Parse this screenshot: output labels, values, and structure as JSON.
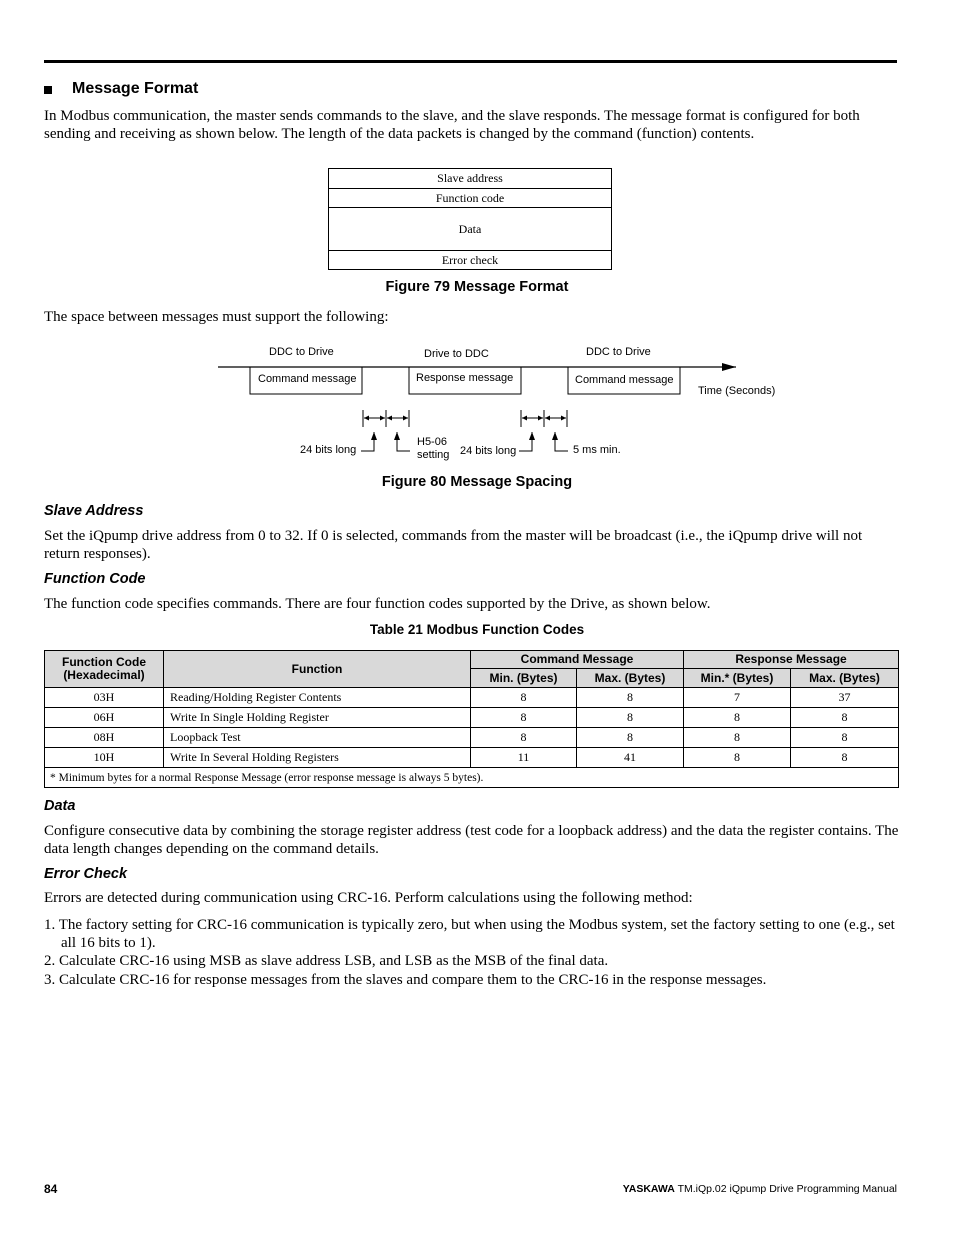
{
  "section": {
    "title": "Message Format",
    "intro": "In Modbus communication, the master sends commands to the slave, and the slave responds. The message format is configured for both sending and receiving as shown below. The length of the data packets is changed by the command (function) contents."
  },
  "figure79": {
    "fields": [
      "Slave address",
      "Function code",
      "Data",
      "Error check"
    ],
    "caption": "Figure 79  Message Format"
  },
  "spacing_intro": "The space between messages must support the following:",
  "figure80": {
    "top_labels": [
      "DDC to Drive",
      "Drive to DDC",
      "DDC to Drive"
    ],
    "boxes": [
      "Command message",
      "Response message",
      "Command message"
    ],
    "axis_label": "Time (Seconds)",
    "gap1_left_label": "24 bits long",
    "gap1_right_label_line1": "H5-06",
    "gap1_right_label_line2": "setting",
    "gap2_left_label": "24 bits long",
    "gap2_right_label": "5 ms min.",
    "caption": "Figure 80  Message Spacing"
  },
  "slave_address": {
    "heading": "Slave Address",
    "text": "Set the iQpump drive address from 0 to 32. If 0 is selected, commands from the master will be broadcast (i.e., the iQpump drive will not return responses)."
  },
  "function_code": {
    "heading": "Function Code",
    "text": "The function code specifies commands. There are four function codes supported by the Drive, as shown below."
  },
  "table21": {
    "caption": "Table 21   Modbus Function Codes",
    "headers": {
      "code": "Function Code (Hexadecimal)",
      "function": "Function",
      "command": "Command Message",
      "response": "Response Message",
      "cmd_min": "Min. (Bytes)",
      "cmd_max": "Max. (Bytes)",
      "resp_min": "Min.* (Bytes)",
      "resp_max": "Max. (Bytes)"
    },
    "rows": [
      {
        "code": "03H",
        "function": "Reading/Holding Register Contents",
        "cmd_min": "8",
        "cmd_max": "8",
        "resp_min": "7",
        "resp_max": "37"
      },
      {
        "code": "06H",
        "function": "Write In Single Holding Register",
        "cmd_min": "8",
        "cmd_max": "8",
        "resp_min": "8",
        "resp_max": "8"
      },
      {
        "code": "08H",
        "function": "Loopback Test",
        "cmd_min": "8",
        "cmd_max": "8",
        "resp_min": "8",
        "resp_max": "8"
      },
      {
        "code": "10H",
        "function": "Write In Several Holding Registers",
        "cmd_min": "11",
        "cmd_max": "41",
        "resp_min": "8",
        "resp_max": "8"
      }
    ],
    "footnote": "* Minimum bytes for a normal Response Message (error response message is always 5 bytes)."
  },
  "data_section": {
    "heading": "Data",
    "text": "Configure consecutive data by combining the storage register address (test code for a loopback address) and the data the register contains. The data length changes depending on the command details."
  },
  "error_check": {
    "heading": "Error Check",
    "text": "Errors are detected during communication using CRC-16. Perform calculations using the following method:",
    "steps": [
      "1. The factory setting for CRC-16 communication is typically zero, but when using the Modbus system, set the factory setting to one (e.g., set all 16 bits to 1).",
      "2. Calculate CRC-16 using MSB as slave address LSB, and LSB as the MSB of the final data.",
      "3. Calculate CRC-16 for response messages from the slaves and compare them to the CRC-16 in the response messages."
    ]
  },
  "footer": {
    "page_number": "84",
    "brand": "YASKAWA",
    "title": "TM.iQp.02 iQpump Drive Programming Manual"
  }
}
